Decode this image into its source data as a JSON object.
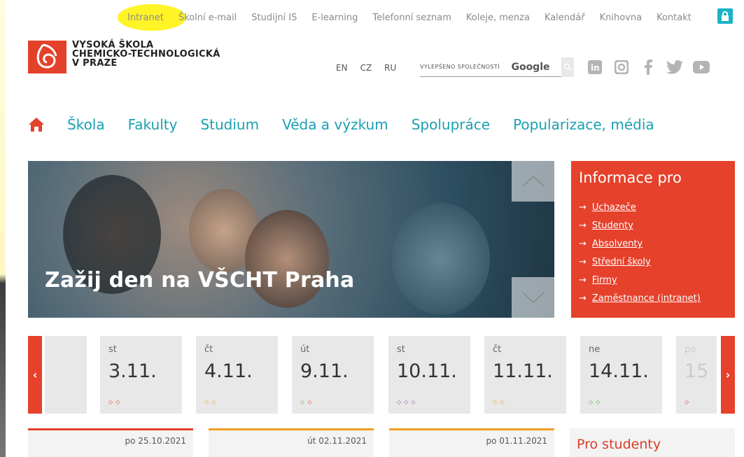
{
  "top_nav": [
    "Intranet",
    "Školní e-mail",
    "Studijní IS",
    "E-learning",
    "Telefonní seznam",
    "Koleje, menza",
    "Kalendář",
    "Knihovna",
    "Kontakt"
  ],
  "logo": {
    "line1": "VYSOKÁ ŠKOLA",
    "line2": "CHEMICKO-TECHNOLOGICKÁ",
    "line3": "V PRAZE"
  },
  "languages": [
    "EN",
    "CZ",
    "RU"
  ],
  "search": {
    "placeholder": "VYLEPŠENO SPOLEČNOSTÍ",
    "brand": "Google"
  },
  "social_icons": [
    "linkedin-icon",
    "instagram-icon",
    "facebook-icon",
    "twitter-icon",
    "youtube-icon"
  ],
  "main_nav": [
    "Škola",
    "Fakulty",
    "Studium",
    "Věda a výzkum",
    "Spolupráce",
    "Popularizace, média"
  ],
  "hero": {
    "caption": "Zažij den na VŠCHT Praha"
  },
  "info_panel": {
    "title": "Informace pro",
    "links": [
      "Uchazeče",
      "Studenty",
      "Absolventy",
      "Střední školy",
      "Firmy",
      "Zaměstnance (intranet)"
    ]
  },
  "calendar": [
    {
      "day": "st",
      "date": "3.11.",
      "dots": [
        "#e5412b",
        "#e5412b"
      ]
    },
    {
      "day": "čt",
      "date": "4.11.",
      "dots": [
        "#f0a020",
        "#f0a020"
      ]
    },
    {
      "day": "út",
      "date": "9.11.",
      "dots": [
        "#5bb04a",
        "#e5412b"
      ]
    },
    {
      "day": "st",
      "date": "10.11.",
      "dots": [
        "#8a5aa8",
        "#8a5aa8",
        "#8a5aa8"
      ]
    },
    {
      "day": "čt",
      "date": "11.11.",
      "dots": [
        "#f0a020",
        "#f0a020"
      ]
    },
    {
      "day": "ne",
      "date": "14.11.",
      "dots": [
        "#5bb04a",
        "#5bb04a"
      ]
    },
    {
      "day": "po",
      "date": "15",
      "dots": [
        "#e5412b"
      ]
    }
  ],
  "news": [
    {
      "date": "po 25.10.2021"
    },
    {
      "date": "út 02.11.2021"
    },
    {
      "date": "po 01.11.2021"
    }
  ],
  "pro_studenty": "Pro studenty",
  "colors": {
    "accent": "#e5412b",
    "nav": "#1aa0b3",
    "highlight": "#fff200"
  }
}
